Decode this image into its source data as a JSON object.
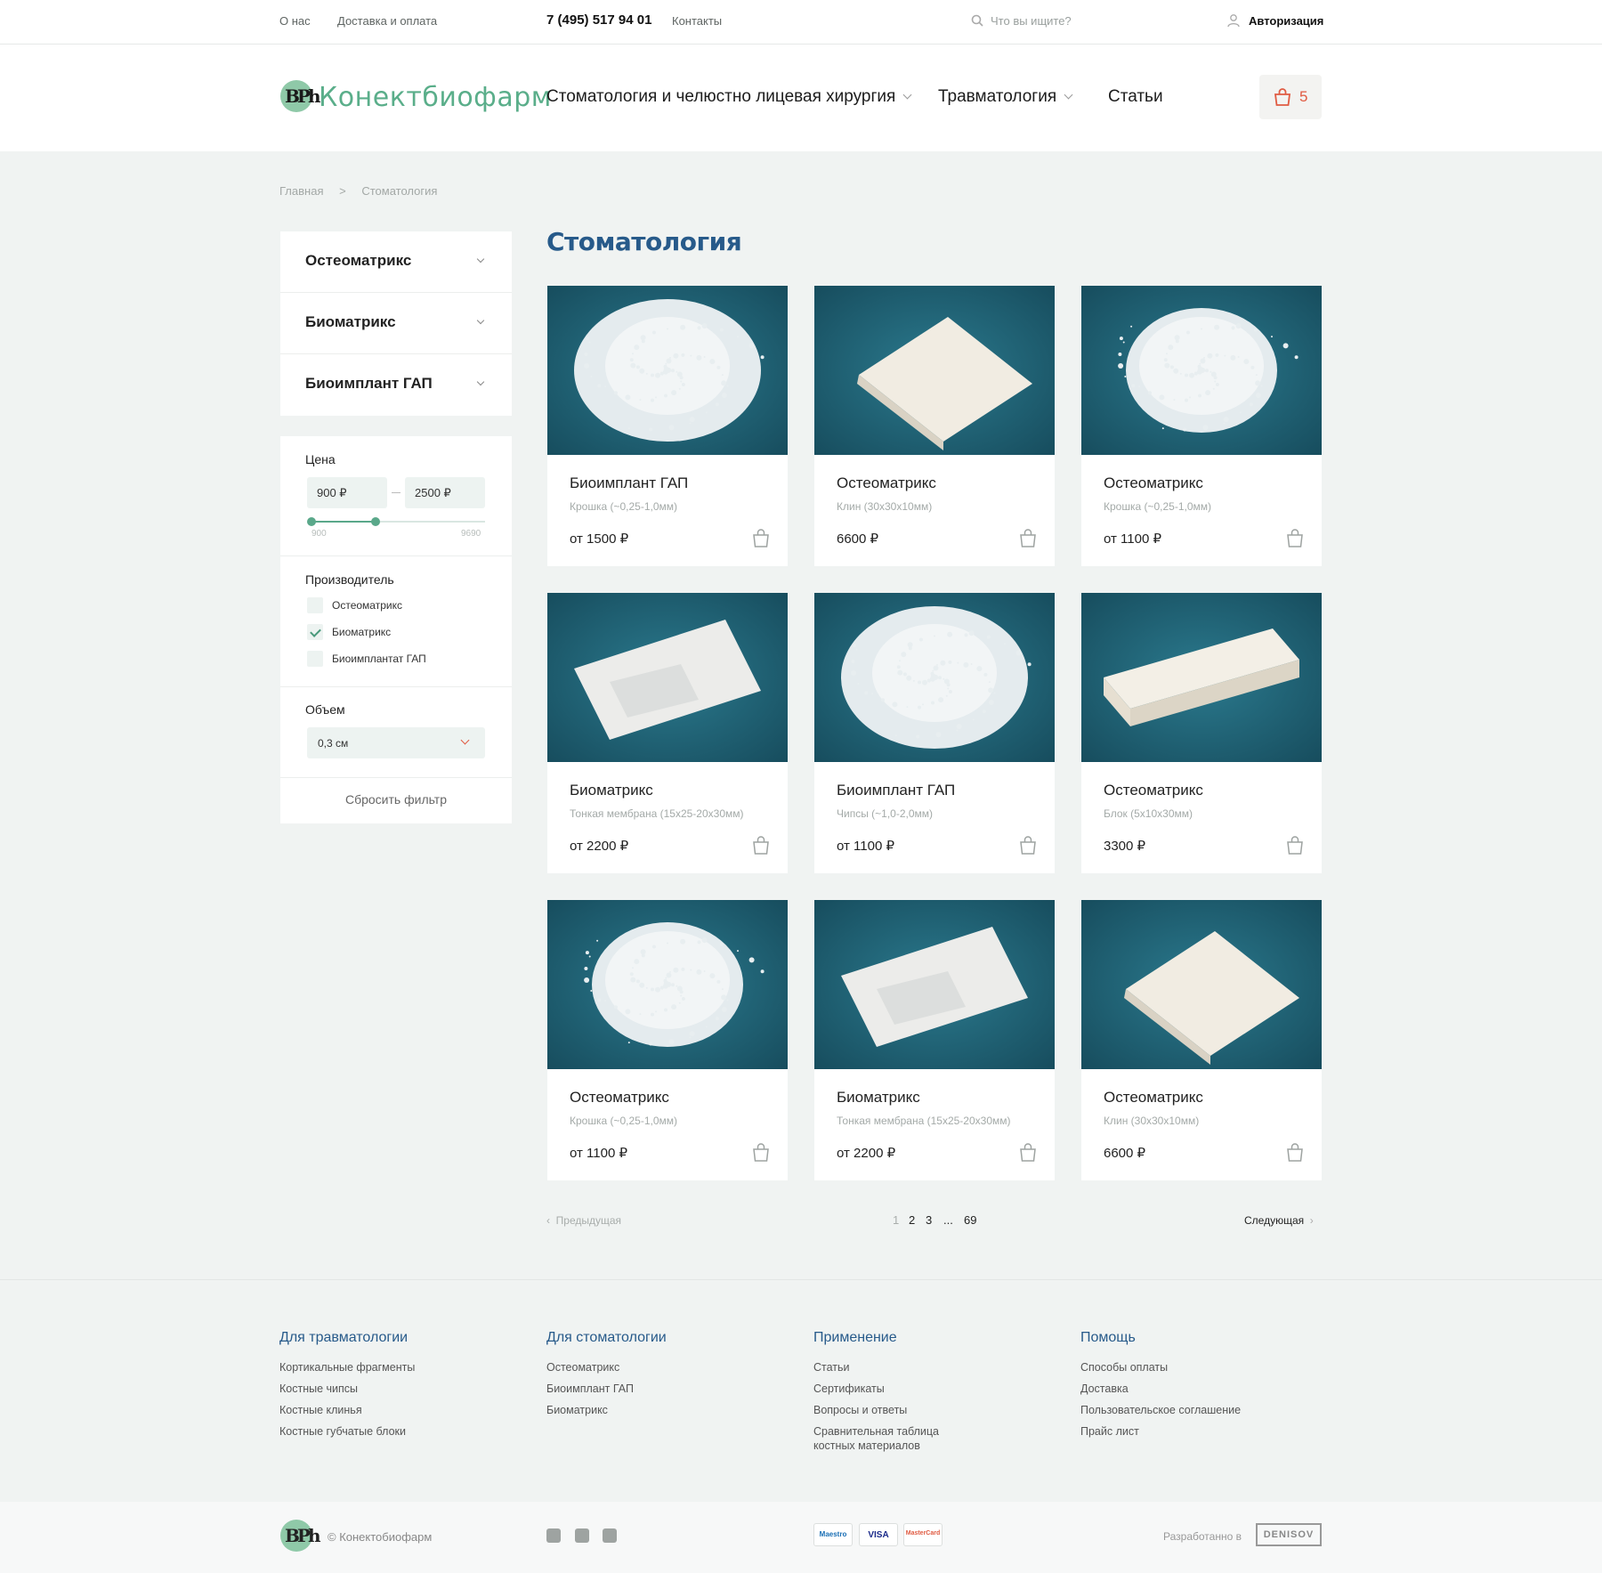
{
  "topbar": {
    "about": "О нас",
    "delivery": "Доставка и оплата",
    "phone": "7 (495) 517 94 01",
    "contacts": "Контакты",
    "search_placeholder": "Что вы ищите?",
    "auth": "Авторизация"
  },
  "header": {
    "logo_text": "Конектбиофарм",
    "logo_mark": "BPh",
    "nav": [
      {
        "label": "Стоматология и челюстно лицевая хирургия",
        "has_dropdown": true
      },
      {
        "label": "Травматология",
        "has_dropdown": true
      },
      {
        "label": "Статьи",
        "has_dropdown": false
      }
    ],
    "cart_count": "5"
  },
  "breadcrumb": {
    "home": "Главная",
    "sep": ">",
    "current": "Стоматология"
  },
  "categories": [
    "Остеоматрикс",
    "Биоматрикс",
    "Биоимплант ГАП"
  ],
  "filter": {
    "price_label": "Цена",
    "price_from": "900 ₽",
    "price_to": "2500 ₽",
    "range_min": "900",
    "range_max": "9690",
    "manufacturer_label": "Производитель",
    "manufacturers": [
      {
        "label": "Остеоматрикс",
        "checked": false
      },
      {
        "label": "Биоматрикс",
        "checked": true
      },
      {
        "label": "Биоимплантат ГАП",
        "checked": false
      }
    ],
    "volume_label": "Объем",
    "volume_value": "0,3 см",
    "reset": "Сбросить фильтр"
  },
  "page_title": "Стоматология",
  "products": [
    {
      "name": "Биоимплант ГАП",
      "sub": "Крошка (~0,25-1,0мм)",
      "price": "от 1500 ₽",
      "image": "powder"
    },
    {
      "name": "Остеоматрикс",
      "sub": "Клин (30х30х10мм)",
      "price": "6600 ₽",
      "image": "wedge"
    },
    {
      "name": "Остеоматрикс",
      "sub": "Крошка (~0,25-1,0мм)",
      "price": "от 1100 ₽",
      "image": "pile"
    },
    {
      "name": "Биоматрикс",
      "sub": "Тонкая мембрана (15х25-20х30мм)",
      "price": "от 2200 ₽",
      "image": "membrane"
    },
    {
      "name": "Биоимплант ГАП",
      "sub": "Чипсы (~1,0-2,0мм)",
      "price": "от 1100 ₽",
      "image": "powder"
    },
    {
      "name": "Остеоматрикс",
      "sub": "Блок (5х10х30мм)",
      "price": "3300 ₽",
      "image": "block"
    },
    {
      "name": "Остеоматрикс",
      "sub": "Крошка (~0,25-1,0мм)",
      "price": "от 1100 ₽",
      "image": "pile"
    },
    {
      "name": "Биоматрикс",
      "sub": "Тонкая мембрана (15х25-20х30мм)",
      "price": "от 2200 ₽",
      "image": "membrane"
    },
    {
      "name": "Остеоматрикс",
      "sub": "Клин (30х30х10мм)",
      "price": "6600 ₽",
      "image": "wedge"
    }
  ],
  "pagination": {
    "prev": "Предыдущая",
    "next": "Следующая",
    "pages": [
      "1",
      "2",
      "3",
      "...",
      "69"
    ],
    "current": "1"
  },
  "footer": {
    "cols": [
      {
        "title": "Для травматологии",
        "links": [
          "Кортикальные фрагменты",
          "Костные чипсы",
          "Костные клинья",
          "Костные губчатые блоки"
        ]
      },
      {
        "title": "Для стоматологии",
        "links": [
          "Остеоматрикс",
          "Биоимплант ГАП",
          "Биоматрикс"
        ]
      },
      {
        "title": "Применение",
        "links": [
          "Статьи",
          "Сертификаты",
          "Вопросы и ответы",
          "Сравнительная таблица",
          "костных материалов"
        ]
      },
      {
        "title": "Помощь",
        "links": [
          "Способы оплаты",
          "Доставка",
          "Пользовательское соглашение",
          "Прайс лист"
        ]
      }
    ],
    "copyright": "© Конектобиофарм",
    "social": [
      "facebook-icon",
      "instagram-icon",
      "telegram-icon"
    ],
    "payments": [
      "Maestro",
      "VISA",
      "MasterCard"
    ],
    "developed_by": "Разработанно в",
    "developer": "DENISOV"
  },
  "colors": {
    "accent": "#e05b42",
    "brand_green": "#5aae8a",
    "title_blue": "#275a8a",
    "image_bg": "#1e5f72"
  }
}
